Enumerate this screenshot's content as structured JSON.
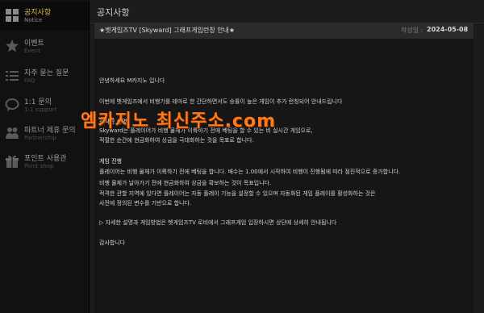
{
  "sidebar": {
    "items": [
      {
        "label": "공지사항",
        "sub": "Notice",
        "icon": "grid-icon",
        "active": true
      },
      {
        "label": "이벤트",
        "sub": "Event",
        "icon": "star-icon",
        "active": false
      },
      {
        "label": "자주 묻는 질문",
        "sub": "FAQ",
        "icon": "list-icon",
        "active": false
      },
      {
        "label": "1:1 문의",
        "sub": "1:1 support",
        "icon": "chat-bubble-icon",
        "active": false
      },
      {
        "label": "파트너 제휴 문의",
        "sub": "Partnership",
        "icon": "people-icon",
        "active": false
      },
      {
        "label": "포인트 사용관",
        "sub": "Point shop",
        "icon": "gift-icon",
        "active": false
      }
    ]
  },
  "page": {
    "title": "공지사항"
  },
  "post": {
    "title": "★벳게임즈TV [Skyward] 그래프게임런칭 안내★",
    "date_label": "작성일 :",
    "date": "2024-05-08",
    "lines": {
      "greeting": "안녕하세요  M카지노 입니다",
      "intro": "이번에 벳게임즈에서 비행기를 테마로 한 간단하면서도 승률이 높은 게임이 추가 런칭되어 안내드립니다",
      "summary_heading": "간략한 설명",
      "summary_1": "Skyward는 플레이어가 비행 물체가 이륙하기 전에 베팅을 할 수 있는 비 실시간 게임으로,",
      "summary_2": "적절한 순간에 현금화하여 상금을 극대화하는 것을 목표로 합니다.",
      "progress_heading": "게임 진행",
      "progress_1": "플레이어는 비행 물체가 이륙하기 전에 베팅을 합니다. 배수는 1.00에서 시작하여 비행이 진행됨에 따라 점진적으로 증가합니다.",
      "progress_2": "비행 물체가 날아가기 전에 현금화하여 상금을 확보하는 것이 목표입니다.",
      "progress_3": "적격한 관할 지역에 있다면 플레이어는 자동 플레이 기능을 설정할 수 있으며 자동화된 게임 플레이를 활성화하는 것은",
      "progress_4": "사전에 정의된 변수를 기반으로 합니다.",
      "more_info": "▷ 자세한 설명과 게임방법은 벳게임즈TV 로비에서 그래프게임 입장하시면 상단에 상세히 안내됩니다",
      "thanks": "감사합니다"
    }
  },
  "watermark": {
    "text": "엠카지노 최신주소.com",
    "color": "#ff7a1a"
  },
  "colors": {
    "active_nav": "#e0b24a",
    "background": "#1b1b1b"
  }
}
